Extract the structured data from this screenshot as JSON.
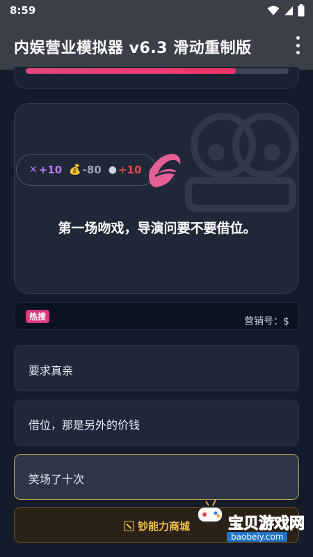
{
  "status": {
    "time": "8:59"
  },
  "app": {
    "title": "内娱营业模拟器 v6.3 滑动重制版"
  },
  "progress": {
    "level": 0.8
  },
  "event": {
    "stats": [
      {
        "icon": "sparkle-icon",
        "glyph": "✕",
        "value": "+10"
      },
      {
        "icon": "money-bag-icon",
        "glyph": "💰",
        "value": "-80"
      },
      {
        "icon": "bomb-icon",
        "glyph": "●",
        "value": "+10"
      }
    ],
    "text": "第一场吻戏，导演问要不要借位。"
  },
  "news": {
    "badge": "热搜",
    "ticker": "营销号：$"
  },
  "choices": [
    {
      "label": "要求真亲"
    },
    {
      "label": "借位，那是另外的价钱"
    },
    {
      "label": "笑场了十次"
    }
  ],
  "shop": {
    "label": "钞能力商城"
  },
  "watermark": {
    "text": "宝贝游戏网",
    "url": "baobeiy.com"
  },
  "colors": {
    "accent": "#f0356a",
    "gold": "#f0c24a",
    "charm": "#b77cf0",
    "risk": "#e54848"
  }
}
